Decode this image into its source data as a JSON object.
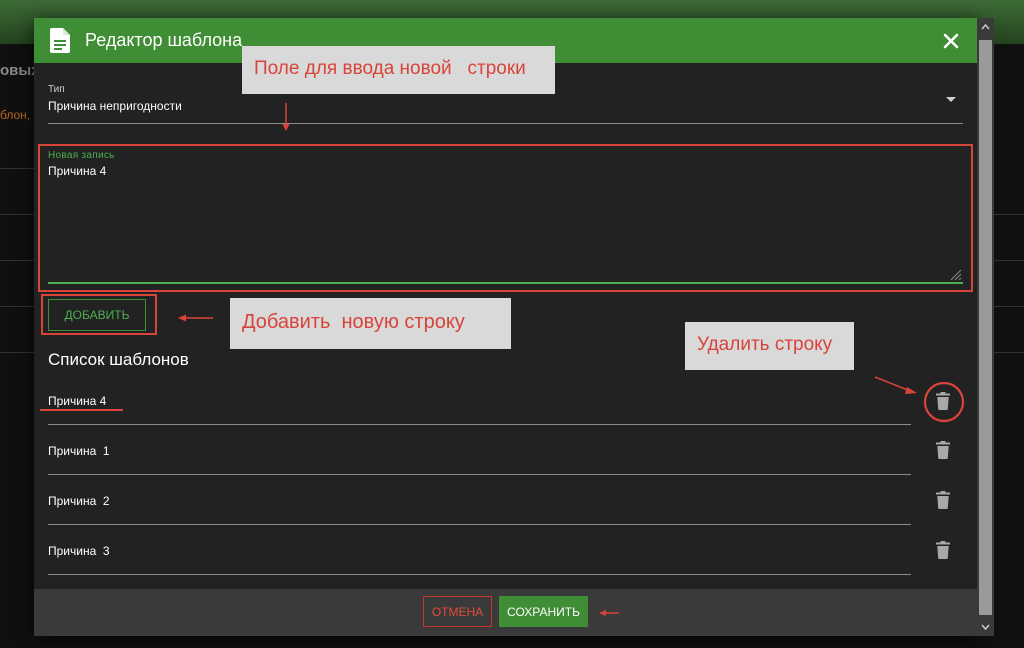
{
  "background": {
    "text1": "овых",
    "text2": "блон,"
  },
  "dialog": {
    "title": "Редактор шаблона",
    "type_label": "Тип",
    "type_value": "Причина непригодности",
    "new_entry_label": "Новая запись",
    "new_entry_value": "Причина 4",
    "add_button": "ДОБАВИТЬ",
    "list_title": "Список шаблонов",
    "items": [
      "Причина 4",
      "Причина  1",
      "Причина  2",
      "Причина  3"
    ],
    "cancel_button": "ОТМЕНА",
    "save_button": "СОХРАНИТЬ"
  },
  "annotations": {
    "input_hint": "Поле для ввода новой   строки",
    "add_hint": "Добавить  новую строку",
    "delete_hint": "Удалить строку"
  },
  "colors": {
    "header_green": "#3f8d34",
    "accent_green": "#4caf50",
    "annotation_red": "#d9443a",
    "dialog_bg": "#222222"
  },
  "icons": {
    "title": "document-icon",
    "close": "close-icon",
    "dropdown": "dropdown-arrow-icon",
    "delete": "trash-icon"
  }
}
